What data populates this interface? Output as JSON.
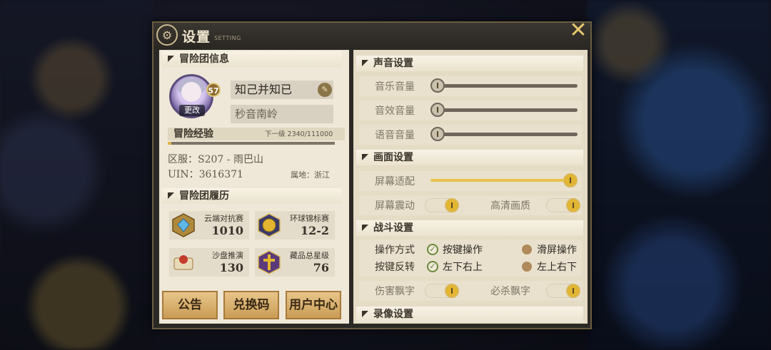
{
  "title": "设置",
  "subtitle": "SETTING",
  "close_icon": "close-icon",
  "left": {
    "team_info_header": "冒险团信息",
    "level": "57",
    "change_label": "更改",
    "name": "知己并知已",
    "server_name": "秒音南岭",
    "exp_label": "冒险经验",
    "exp_next": "下一级 2340/111000",
    "exp_progress": 0.021,
    "realm_line": "区服：S207 - 雨巴山",
    "uin_line": "UIN：3616371",
    "region_line": "属地：浙江",
    "history_header": "冒险团履历",
    "stats": [
      {
        "label": "云端对抗赛",
        "value": "1010",
        "icon": "diamond-badge-icon"
      },
      {
        "label": "环球锦标赛",
        "value": "12-2",
        "icon": "gold-trophy-icon"
      },
      {
        "label": "沙盘推演",
        "value": "130",
        "icon": "sand-table-icon"
      },
      {
        "label": "藏品总星级",
        "value": "76",
        "icon": "star-collection-icon"
      }
    ],
    "buttons": {
      "notice": "公告",
      "redeem": "兑换码",
      "user_center": "用户中心"
    }
  },
  "right": {
    "sound_header": "声音设置",
    "music_label": "音乐音量",
    "music_level": 0,
    "sfx_label": "音效音量",
    "sfx_level": 0,
    "voice_label": "语音音量",
    "voice_level": 0,
    "display_header": "画面设置",
    "screen_fit_label": "屏幕适配",
    "screen_fit_level": 1.0,
    "shake_label": "屏幕震动",
    "hd_label": "高清画质",
    "battle_header": "战斗设置",
    "control_label": "操作方式",
    "control_opt1": "按键操作",
    "control_opt2": "滑屏操作",
    "invert_label": "按键反转",
    "invert_opt1": "左下右上",
    "invert_opt2": "左上右下",
    "damage_label": "伤害飘字",
    "crit_label": "必杀飘字",
    "record_header": "录像设置"
  },
  "colors": {
    "accent_gold": "#e3b530",
    "panel_dark": "#2b2925"
  }
}
